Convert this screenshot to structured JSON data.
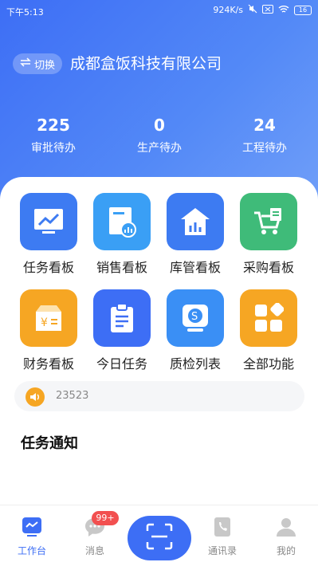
{
  "status": {
    "time": "下午5:13",
    "speed": "924K/s",
    "battery": "16"
  },
  "header": {
    "switch_label": "切换",
    "company": "成都盒饭科技有限公司",
    "stats": [
      {
        "value": "225",
        "label": "审批待办"
      },
      {
        "value": "0",
        "label": "生产待办"
      },
      {
        "value": "24",
        "label": "工程待办"
      }
    ]
  },
  "grid": [
    {
      "label": "任务看板",
      "icon": "chart-board-icon",
      "color": "#3d7bf2"
    },
    {
      "label": "销售看板",
      "icon": "sales-report-icon",
      "color": "#3a9ff5"
    },
    {
      "label": "库管看板",
      "icon": "warehouse-icon",
      "color": "#3d7bf2"
    },
    {
      "label": "采购看板",
      "icon": "shopping-cart-icon",
      "color": "#3fbb79"
    },
    {
      "label": "财务看板",
      "icon": "finance-box-icon",
      "color": "#f6a623"
    },
    {
      "label": "今日任务",
      "icon": "clipboard-icon",
      "color": "#3d6ef5"
    },
    {
      "label": "质检列表",
      "icon": "quality-check-icon",
      "color": "#3a8ff5"
    },
    {
      "label": "全部功能",
      "icon": "all-apps-icon",
      "color": "#f6a623"
    }
  ],
  "notice": {
    "text": "23523"
  },
  "section": {
    "title": "任务通知"
  },
  "tabs": [
    {
      "label": "工作台",
      "icon": "workbench-icon",
      "active": true
    },
    {
      "label": "消息",
      "icon": "message-icon",
      "badge": "99+"
    },
    {
      "label": "",
      "icon": "scan-icon"
    },
    {
      "label": "通讯录",
      "icon": "contacts-icon"
    },
    {
      "label": "我的",
      "icon": "profile-icon"
    }
  ],
  "colors": {
    "primary": "#3d6ef5",
    "accent": "#f6a623",
    "badge": "#f25050"
  }
}
